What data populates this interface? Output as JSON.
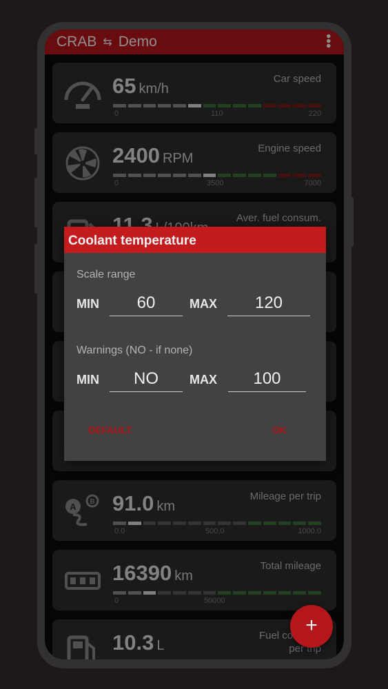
{
  "appbar": {
    "title_left": "CRAB",
    "swap_icon": "⇆",
    "title_right": "Demo"
  },
  "cards": [
    {
      "icon": "speedometer-icon",
      "value": "65",
      "unit": "km/h",
      "label": "Car speed",
      "ticks": [
        "0",
        "110",
        "220"
      ]
    },
    {
      "icon": "fan-icon",
      "value": "2400",
      "unit": "RPM",
      "label": "Engine speed",
      "ticks": [
        "0",
        "3500",
        "7000"
      ]
    },
    {
      "icon": "fuel-icon",
      "value": "11.3",
      "unit": "L/100km",
      "label": "Aver. fuel consum.",
      "ticks": []
    },
    {
      "icon": "trip-icon",
      "value": "91.0",
      "unit": "km",
      "label": "Mileage per trip",
      "ticks": [
        "0.0",
        "500.0",
        "1000.0"
      ]
    },
    {
      "icon": "odometer-icon",
      "value": "16390",
      "unit": "km",
      "label": "Total mileage",
      "ticks": [
        "0",
        "50000",
        ""
      ]
    },
    {
      "icon": "fuel-pump-icon",
      "value": "10.3",
      "unit": "L",
      "label": "Fuel consum. per trip",
      "ticks": []
    }
  ],
  "dialog": {
    "title": "Coolant temperature",
    "scale_section": "Scale range",
    "warnings_section": "Warnings (NO - if none)",
    "min_label": "MIN",
    "max_label": "MAX",
    "scale_min": "60",
    "scale_max": "120",
    "warn_min": "NO",
    "warn_max": "100",
    "default_button": "DEFAULT",
    "ok_button": "OK"
  },
  "fab": {
    "label": "+"
  },
  "colors": {
    "accent": "#b3161b",
    "card": "#2e2e2e",
    "dialog": "#424242"
  }
}
